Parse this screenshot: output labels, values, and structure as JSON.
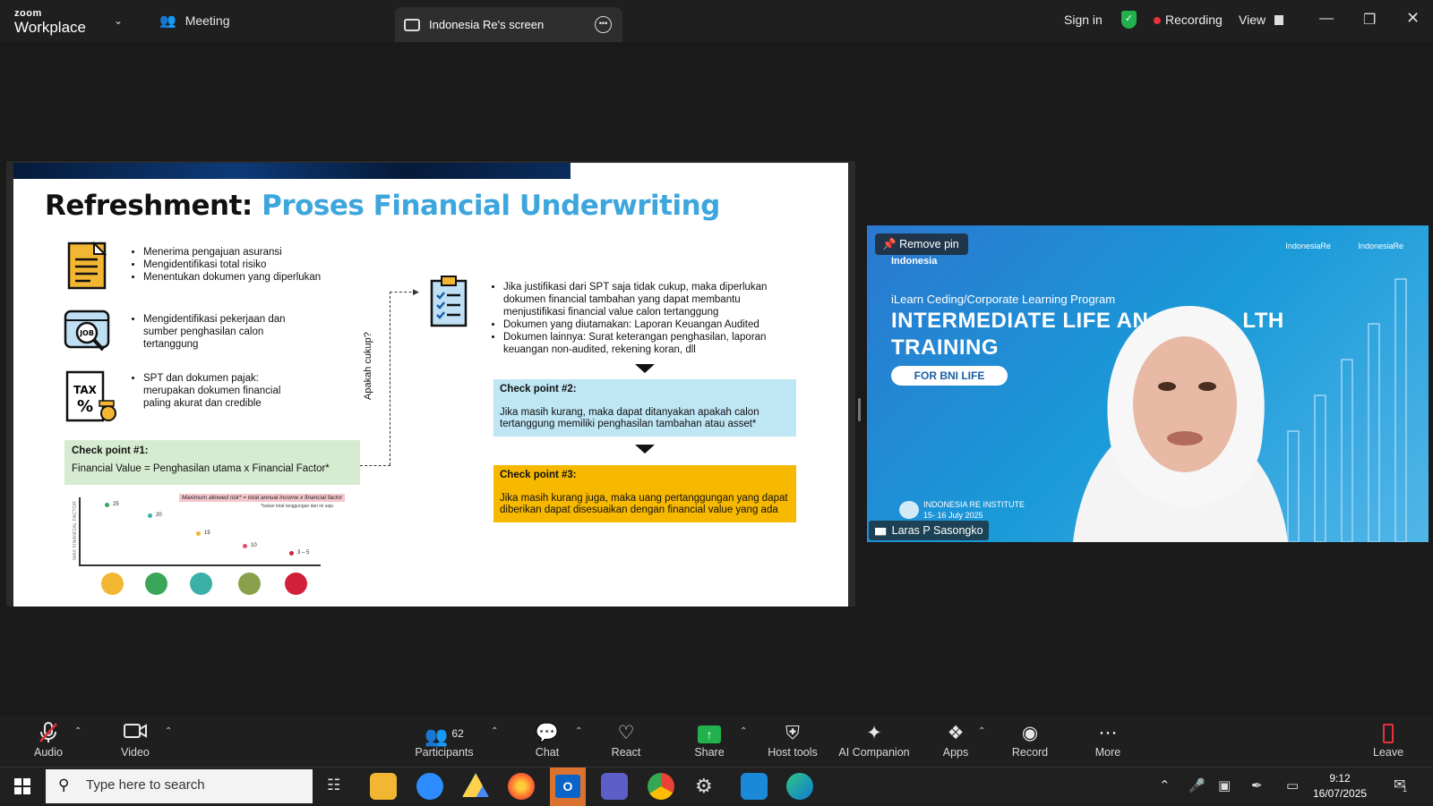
{
  "titlebar": {
    "brand_top": "zoom",
    "brand_bottom": "Workplace",
    "meeting_label": "Meeting",
    "share_tab_label": "Indonesia Re's screen",
    "sign_in": "Sign in",
    "recording": "Recording",
    "view": "View",
    "accent_recording": "#e5323b",
    "accent_shield": "#22b14c"
  },
  "slide": {
    "title_black": "Refreshment:",
    "title_blue": "Proses Financial Underwriting",
    "title_blue_color": "#3da6dd",
    "group1": [
      "Menerima pengajuan asuransi",
      "Mengidentifikasi total risiko",
      "Menentukan dokumen yang diperlukan"
    ],
    "group2": [
      "Mengidentifikasi pekerjaan dan sumber penghasilan calon tertanggung"
    ],
    "group3": [
      "SPT dan dokumen pajak: merupakan dokumen financial paling akurat dan credible"
    ],
    "group4": [
      "Jika justifikasi dari SPT saja tidak cukup, maka diperlukan dokumen financial tambahan yang dapat membantu menjustifikasi financial value calon tertanggung",
      "Dokumen yang diutamakan: Laporan Keuangan Audited",
      "Dokumen lainnya: Surat keterangan penghasilan, laporan keuangan non-audited, rekening koran, dll"
    ],
    "job_icon_label": "JOB",
    "tax_icon_label": "TAX",
    "apakah": "Apakah cukup?",
    "cp1_title": "Check point #1:",
    "cp1_body": "Financial Value = Penghasilan utama x Financial Factor*",
    "cp2_title": "Check point #2:",
    "cp2_body": "Jika masih kurang, maka dapat ditanyakan apakah calon tertanggung memiliki penghasilan tambahan atau asset*",
    "cp3_title": "Check point #3:",
    "cp3_body": "Jika masih kurang juga, maka uang pertanggungan yang dapat diberikan dapat disesuaikan dengan financial value yang ada",
    "mini_chart_label": "Maximum allowed risk* = total annual income x financial factor",
    "mini_chart_note": "*bukan total tanggungan dari ini saja",
    "mini_chart_yaxis": "MAX FINANCIAL FACTOR",
    "mini_chart_points": [
      {
        "label": "25",
        "color": "#3aa65a"
      },
      {
        "label": "20",
        "color": "#3ab0a6"
      },
      {
        "label": "15",
        "color": "#f2b632"
      },
      {
        "label": "10",
        "color": "#e0506a"
      },
      {
        "label": "3 – 5",
        "color": "#d0203a"
      }
    ]
  },
  "video": {
    "remove_pin": "Remove pin",
    "brand_small": "Indonesia",
    "logo_left": "IndonesiaRe",
    "logo_right": "IndonesiaRe",
    "program": "iLearn Ceding/Corporate Learning Program",
    "headline1": "INTERMEDIATE LIFE AN",
    "headline1_end": "LTH",
    "headline2": "TRAINING",
    "pill": "FOR BNI LIFE",
    "institute": "INDONESIA RE INSTITUTE",
    "dates": "15- 16 July 2025",
    "participant_name": "Laras P Sasongko"
  },
  "toolbar": {
    "audio": "Audio",
    "video": "Video",
    "participants": "Participants",
    "participants_count": "62",
    "chat": "Chat",
    "react": "React",
    "share": "Share",
    "host_tools": "Host tools",
    "ai_companion": "AI Companion",
    "apps": "Apps",
    "record": "Record",
    "more": "More",
    "leave": "Leave",
    "share_color": "#22b14c",
    "leave_color": "#e5323b"
  },
  "taskbar": {
    "search_placeholder": "Type here to search",
    "time": "9:12",
    "date": "16/07/2025",
    "notification_count": "1"
  }
}
